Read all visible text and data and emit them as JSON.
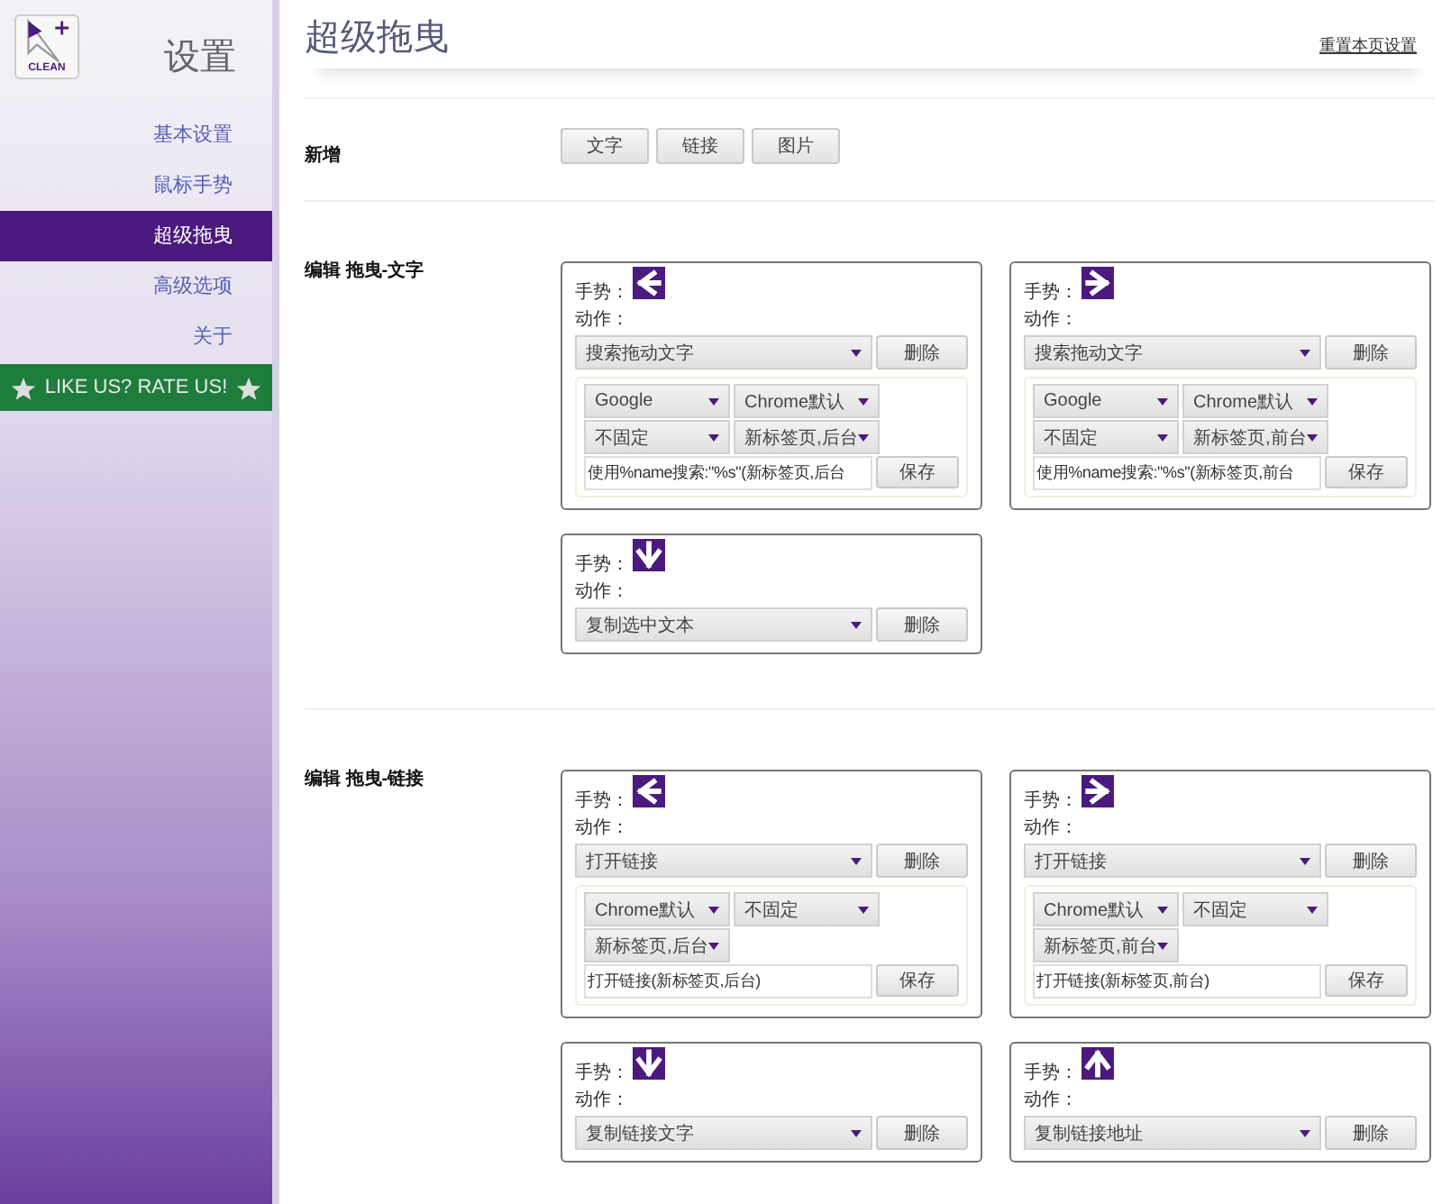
{
  "sidebar": {
    "logo_label": "CLEAN",
    "title": "设置",
    "items": [
      {
        "label": "基本设置",
        "selected": false
      },
      {
        "label": "鼠标手势",
        "selected": false
      },
      {
        "label": "超级拖曳",
        "selected": true
      },
      {
        "label": "高级选项",
        "selected": false
      },
      {
        "label": "关于",
        "selected": false
      }
    ],
    "rate_banner": "LIKE US? RATE US!"
  },
  "main": {
    "title": "超级拖曳",
    "reset_link": "重置本页设置",
    "add_section": {
      "label": "新增",
      "buttons": [
        "文字",
        "链接",
        "图片"
      ]
    },
    "sections": [
      {
        "title": "编辑 拖曳-文字",
        "cards": [
          {
            "gesture_label": "手势：",
            "kind": "left",
            "action_label": "动作：",
            "action": "搜索拖动文字",
            "delete": "删除",
            "options": {
              "selects": [
                "Google",
                "Chrome默认",
                "不固定",
                "新标签页,后台"
              ],
              "command": "使用%name搜索:\"%s\"(新标签页,后台",
              "save": "保存"
            }
          },
          {
            "gesture_label": "手势：",
            "kind": "right",
            "action_label": "动作：",
            "action": "搜索拖动文字",
            "delete": "删除",
            "options": {
              "selects": [
                "Google",
                "Chrome默认",
                "不固定",
                "新标签页,前台"
              ],
              "command": "使用%name搜索:\"%s\"(新标签页,前台",
              "save": "保存"
            }
          },
          {
            "gesture_label": "手势：",
            "kind": "down",
            "action_label": "动作：",
            "action": "复制选中文本",
            "delete": "删除"
          }
        ]
      },
      {
        "title": "编辑 拖曳-链接",
        "cards": [
          {
            "gesture_label": "手势：",
            "kind": "left",
            "action_label": "动作：",
            "action": "打开链接",
            "delete": "删除",
            "options": {
              "selects": [
                "Chrome默认",
                "不固定",
                "新标签页,后台"
              ],
              "command": "打开链接(新标签页,后台)",
              "save": "保存"
            }
          },
          {
            "gesture_label": "手势：",
            "kind": "right",
            "action_label": "动作：",
            "action": "打开链接",
            "delete": "删除",
            "options": {
              "selects": [
                "Chrome默认",
                "不固定",
                "新标签页,前台"
              ],
              "command": "打开链接(新标签页,前台)",
              "save": "保存"
            }
          },
          {
            "gesture_label": "手势：",
            "kind": "down",
            "action_label": "动作：",
            "action": "复制链接文字",
            "delete": "删除"
          },
          {
            "gesture_label": "手势：",
            "kind": "up",
            "action_label": "动作：",
            "action": "复制链接地址",
            "delete": "删除"
          }
        ]
      }
    ]
  }
}
